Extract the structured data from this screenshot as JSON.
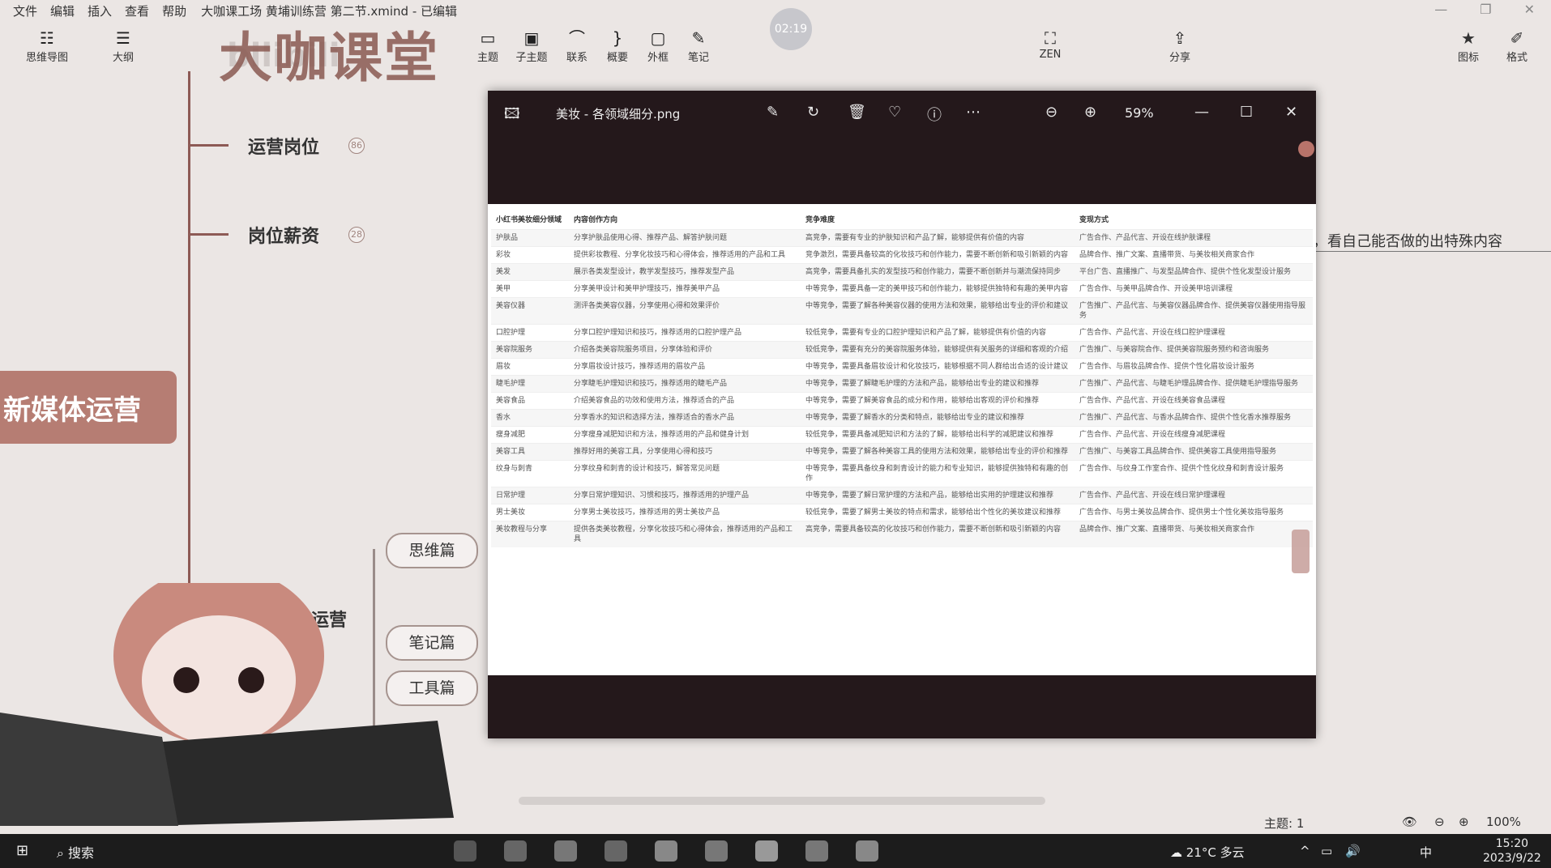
{
  "menu": {
    "items": [
      "文件",
      "编辑",
      "插入",
      "查看",
      "帮助"
    ],
    "window_title": "大咖课工场 黄埔训练营 第二节.xmind - 已编辑"
  },
  "toolbar": {
    "left": [
      {
        "label": "思维导图",
        "icon": "mindmap-icon"
      },
      {
        "label": "大纲",
        "icon": "outline-icon"
      }
    ],
    "center": [
      {
        "label": "主题",
        "icon": "topic-icon"
      },
      {
        "label": "子主题",
        "icon": "subtopic-icon"
      },
      {
        "label": "联系",
        "icon": "relationship-icon"
      },
      {
        "label": "概要",
        "icon": "summary-icon"
      },
      {
        "label": "外框",
        "icon": "boundary-icon"
      },
      {
        "label": "笔记",
        "icon": "note-icon"
      }
    ],
    "zen": "ZEN",
    "share": "分享",
    "right": [
      {
        "label": "图标",
        "icon": "star-icon"
      },
      {
        "label": "格式",
        "icon": "brush-icon"
      }
    ],
    "timer": "02:19"
  },
  "watermark": {
    "text": "大咖课堂",
    "bili": "bilibili"
  },
  "mindmap": {
    "root": "新媒体运营",
    "branches": [
      {
        "label": "运营岗位",
        "count": "86"
      },
      {
        "label": "岗位薪资",
        "count": "28"
      },
      {
        "label": "红书运营",
        "count": ""
      }
    ],
    "sub": [
      "思维篇",
      "笔记篇",
      "工具篇"
    ],
    "side_note": "，看自己能否做的出特殊内容"
  },
  "viewer": {
    "title": "美妆 - 各领域细分.png",
    "zoom": "59%",
    "table": {
      "headers": [
        "小红书美妆细分领域",
        "内容创作方向",
        "竞争难度",
        "变现方式"
      ],
      "rows": [
        [
          "护肤品",
          "分享护肤品使用心得、推荐产品、解答护肤问题",
          "高竞争，需要有专业的护肤知识和产品了解，能够提供有价值的内容",
          "广告合作、产品代言、开设在线护肤课程"
        ],
        [
          "彩妆",
          "提供彩妆教程、分享化妆技巧和心得体会，推荐适用的产品和工具",
          "竞争激烈，需要具备较高的化妆技巧和创作能力，需要不断创新和吸引新颖的内容",
          "品牌合作、推广文案、直播带货、与美妆相关商家合作"
        ],
        [
          "美发",
          "展示各类发型设计，教学发型技巧，推荐发型产品",
          "高竞争，需要具备扎实的发型技巧和创作能力，需要不断创新并与潮流保持同步",
          "平台广告、直播推广、与发型品牌合作、提供个性化发型设计服务"
        ],
        [
          "美甲",
          "分享美甲设计和美甲护理技巧，推荐美甲产品",
          "中等竞争，需要具备一定的美甲技巧和创作能力，能够提供独特和有趣的美甲内容",
          "广告合作、与美甲品牌合作、开设美甲培训课程"
        ],
        [
          "美容仪器",
          "测评各类美容仪器，分享使用心得和效果评价",
          "中等竞争，需要了解各种美容仪器的使用方法和效果，能够给出专业的评价和建议",
          "广告推广、产品代言、与美容仪器品牌合作、提供美容仪器使用指导服务"
        ],
        [
          "口腔护理",
          "分享口腔护理知识和技巧，推荐适用的口腔护理产品",
          "较低竞争，需要有专业的口腔护理知识和产品了解，能够提供有价值的内容",
          "广告合作、产品代言、开设在线口腔护理课程"
        ],
        [
          "美容院服务",
          "介绍各类美容院服务项目，分享体验和评价",
          "较低竞争，需要有充分的美容院服务体验，能够提供有关服务的详细和客观的介绍",
          "广告推广、与美容院合作、提供美容院服务预约和咨询服务"
        ],
        [
          "眉妆",
          "分享眉妆设计技巧，推荐适用的眉妆产品",
          "中等竞争，需要具备眉妆设计和化妆技巧，能够根据不同人群给出合适的设计建议",
          "广告合作、与眉妆品牌合作、提供个性化眉妆设计服务"
        ],
        [
          "睫毛护理",
          "分享睫毛护理知识和技巧，推荐适用的睫毛产品",
          "中等竞争，需要了解睫毛护理的方法和产品，能够给出专业的建议和推荐",
          "广告推广、产品代言、与睫毛护理品牌合作、提供睫毛护理指导服务"
        ],
        [
          "美容食品",
          "介绍美容食品的功效和使用方法，推荐适合的产品",
          "中等竞争，需要了解美容食品的成分和作用，能够给出客观的评价和推荐",
          "广告合作、产品代言、开设在线美容食品课程"
        ],
        [
          "香水",
          "分享香水的知识和选择方法，推荐适合的香水产品",
          "中等竞争，需要了解香水的分类和特点，能够给出专业的建议和推荐",
          "广告推广、产品代言、与香水品牌合作、提供个性化香水推荐服务"
        ],
        [
          "瘦身减肥",
          "分享瘦身减肥知识和方法，推荐适用的产品和健身计划",
          "较低竞争，需要具备减肥知识和方法的了解，能够给出科学的减肥建议和推荐",
          "广告合作、产品代言、开设在线瘦身减肥课程"
        ],
        [
          "美容工具",
          "推荐好用的美容工具，分享使用心得和技巧",
          "中等竞争，需要了解各种美容工具的使用方法和效果，能够给出专业的评价和推荐",
          "广告推广、与美容工具品牌合作、提供美容工具使用指导服务"
        ],
        [
          "纹身与刺青",
          "分享纹身和刺青的设计和技巧，解答常见问题",
          "中等竞争，需要具备纹身和刺青设计的能力和专业知识，能够提供独特和有趣的创作",
          "广告合作、与纹身工作室合作、提供个性化纹身和刺青设计服务"
        ],
        [
          "日常护理",
          "分享日常护理知识、习惯和技巧，推荐适用的护理产品",
          "中等竞争，需要了解日常护理的方法和产品，能够给出实用的护理建议和推荐",
          "广告合作、产品代言、开设在线日常护理课程"
        ],
        [
          "男士美妆",
          "分享男士美妆技巧，推荐适用的男士美妆产品",
          "较低竞争，需要了解男士美妆的特点和需求，能够给出个性化的美妆建议和推荐",
          "广告合作、与男士美妆品牌合作、提供男士个性化美妆指导服务"
        ],
        [
          "美妆教程与分享",
          "提供各类美妆教程，分享化妆技巧和心得体会，推荐适用的产品和工具",
          "高竞争，需要具备较高的化妆技巧和创作能力，需要不断创新和吸引新颖的内容",
          "品牌合作、推广文案、直播带货、与美妆相关商家合作"
        ]
      ]
    }
  },
  "status": {
    "topic": "主题: 1",
    "zoom": "100%"
  },
  "taskbar": {
    "search": "搜索",
    "weather": "21°C 多云",
    "ime": "中",
    "time": "15:20",
    "date": "2023/9/22"
  }
}
